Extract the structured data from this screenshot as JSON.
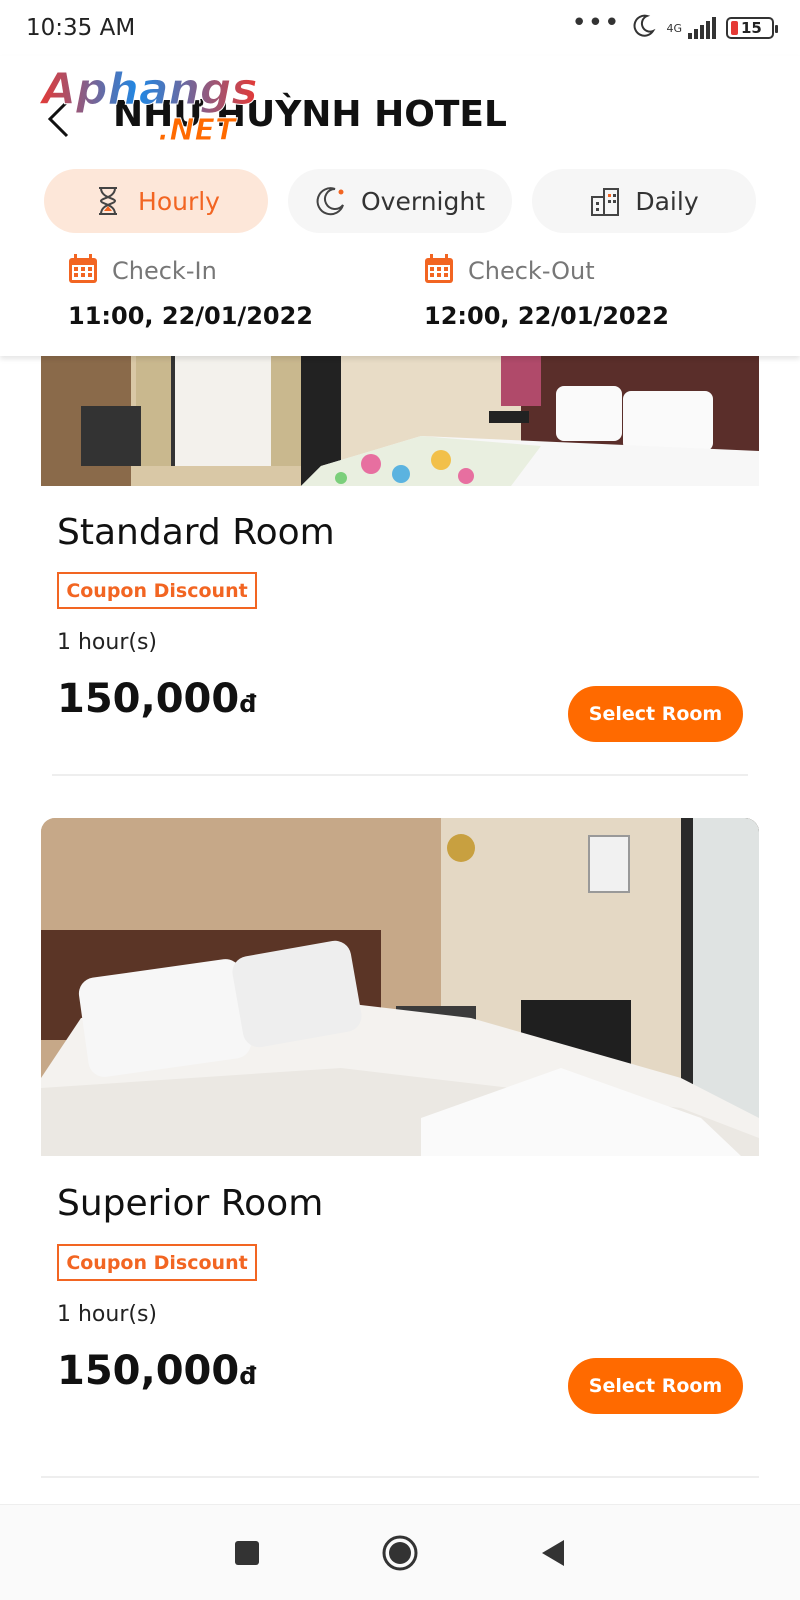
{
  "status_bar": {
    "time": "10:35 AM",
    "dots": "•••",
    "network": "4G",
    "battery": "15"
  },
  "header": {
    "title": "NHƯ HUỲNH HOTEL",
    "tabs": [
      {
        "label": "Hourly",
        "icon": "hourglass-icon",
        "active": true
      },
      {
        "label": "Overnight",
        "icon": "moon-icon",
        "active": false
      },
      {
        "label": "Daily",
        "icon": "building-icon",
        "active": false
      }
    ],
    "check_in": {
      "label": "Check-In",
      "value": "11:00, 22/01/2022"
    },
    "check_out": {
      "label": "Check-Out",
      "value": "12:00, 22/01/2022"
    }
  },
  "watermark": {
    "line1": "Aphangs",
    "line2": ".NET"
  },
  "rooms": [
    {
      "name": "Standard Room",
      "badge": "Coupon Discount",
      "duration": "1 hour(s)",
      "price": "150,000",
      "currency": "đ",
      "button": "Select Room"
    },
    {
      "name": "Superior Room",
      "badge": "Coupon Discount",
      "duration": "1 hour(s)",
      "price": "150,000",
      "currency": "đ",
      "button": "Select Room"
    }
  ],
  "colors": {
    "accent": "#ff6a00",
    "accent_text": "#f26522",
    "active_tab_bg": "#fde7d9"
  },
  "nav": {
    "icons": [
      "recent-apps-icon",
      "home-icon",
      "back-nav-icon"
    ]
  }
}
